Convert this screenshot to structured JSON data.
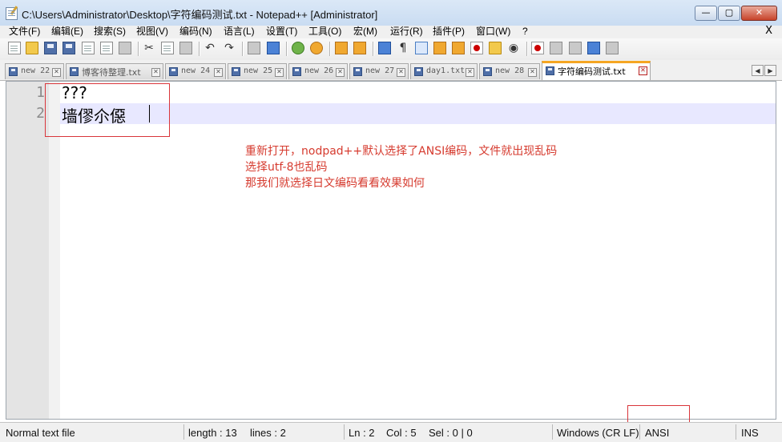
{
  "window": {
    "title": "C:\\Users\\Administrator\\Desktop\\字符编码测试.txt - Notepad++ [Administrator]",
    "minimize_glyph": "—",
    "maximize_glyph": "▢",
    "close_glyph": "✕"
  },
  "menu": {
    "items": [
      "文件(F)",
      "编辑(E)",
      "搜索(S)",
      "视图(V)",
      "编码(N)",
      "语言(L)",
      "设置(T)",
      "工具(O)",
      "宏(M)",
      "运行(R)",
      "插件(P)",
      "窗口(W)",
      "?"
    ],
    "close": "X"
  },
  "tabs": [
    {
      "label": "new 22",
      "active": false
    },
    {
      "label": "博客待整理.txt",
      "active": false
    },
    {
      "label": "new 24",
      "active": false
    },
    {
      "label": "new 25",
      "active": false
    },
    {
      "label": "new 26",
      "active": false
    },
    {
      "label": "new 27",
      "active": false
    },
    {
      "label": "day1.txt",
      "active": false
    },
    {
      "label": "new 28",
      "active": false
    },
    {
      "label": "字符编码测试.txt",
      "active": true
    }
  ],
  "tab_close_glyph": "✕",
  "tab_nav": {
    "left": "◀",
    "right": "▶"
  },
  "editor": {
    "lines": [
      {
        "number": "1",
        "text": "???"
      },
      {
        "number": "2",
        "text": "墙僇尒僫"
      }
    ]
  },
  "annotation": {
    "lines": [
      "重新打开，nodpad++默认选择了ANSI编码，文件就出现乱码",
      "选择utf-8也乱码",
      "那我们就选择日文编码看看效果如何"
    ],
    "color": "#d63b2f"
  },
  "status": {
    "file_type": "Normal text file",
    "length": "length : 13",
    "lines": "lines : 2",
    "ln": "Ln : 2",
    "col": "Col : 5",
    "sel": "Sel : 0 | 0",
    "eol": "Windows (CR LF)",
    "encoding": "ANSI",
    "mode": "INS"
  },
  "colors": {
    "highlight_box": "#d9353a",
    "current_line": "#e8e8ff",
    "active_tab_accent": "#f5a623"
  }
}
